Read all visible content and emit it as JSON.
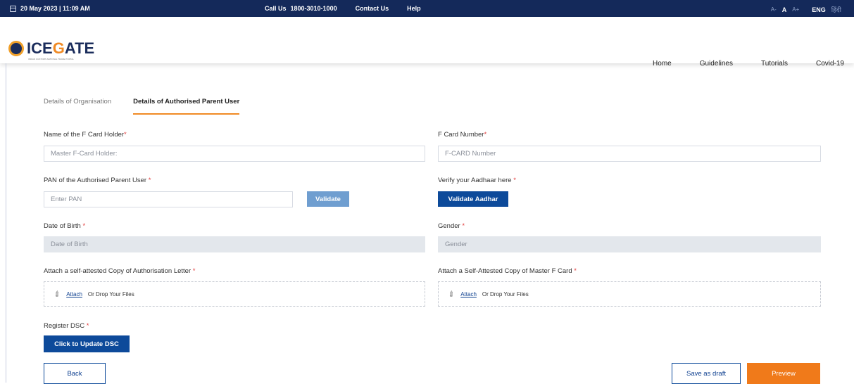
{
  "topbar": {
    "datetime": "20 May 2023 | 11:09 AM",
    "call_label": "Call Us",
    "call_number": "1800-3010-1000",
    "contact": "Contact Us",
    "help": "Help",
    "font_small": "A-",
    "font_normal": "A",
    "font_large": "A+",
    "lang_en": "ENG",
    "lang_hi": "हिंदी"
  },
  "header": {
    "logo_main": "ICE",
    "logo_accent": "G",
    "logo_end": "ATE",
    "tagline": "INDIAN CUSTOMS NATIONAL TRADE PORTAL",
    "nav": [
      "Home",
      "Guidelines",
      "Tutorials",
      "Covid-19"
    ]
  },
  "tabs": [
    {
      "label": "Details of Organisation",
      "active": false
    },
    {
      "label": "Details of Authorised Parent User",
      "active": true
    }
  ],
  "form": {
    "fcard_holder_label": "Name of the F Card Holder",
    "fcard_holder_placeholder": "Master F-Card Holder:",
    "fcard_number_label": "F Card Number",
    "fcard_number_placeholder": "F-CARD Number",
    "pan_label": "PAN of the Authorised Parent User ",
    "pan_placeholder": "Enter PAN",
    "validate_btn": "Validate",
    "aadhaar_label": "Verify your Aadhaar here ",
    "aadhaar_btn": "Validate Aadhar",
    "dob_label": "Date of Birth ",
    "dob_placeholder": "Date of Birth",
    "gender_label": "Gender ",
    "gender_placeholder": "Gender",
    "auth_letter_label": "Attach a self-attested Copy of Authorisation Letter ",
    "master_fcard_label": "Attach a Self-Attested Copy of Master F Card ",
    "attach_link": "Attach",
    "drop_text": "Or Drop Your Files",
    "dsc_label": "Register DSC ",
    "dsc_btn": "Click to Update DSC",
    "required_mark": "*"
  },
  "footer": {
    "back": "Back",
    "save_draft": "Save as draft",
    "preview": "Preview"
  },
  "colors": {
    "topbar": "#14295a",
    "primary": "#0d4a9a",
    "accent": "#f08a24",
    "validate": "#6f9ed0"
  }
}
